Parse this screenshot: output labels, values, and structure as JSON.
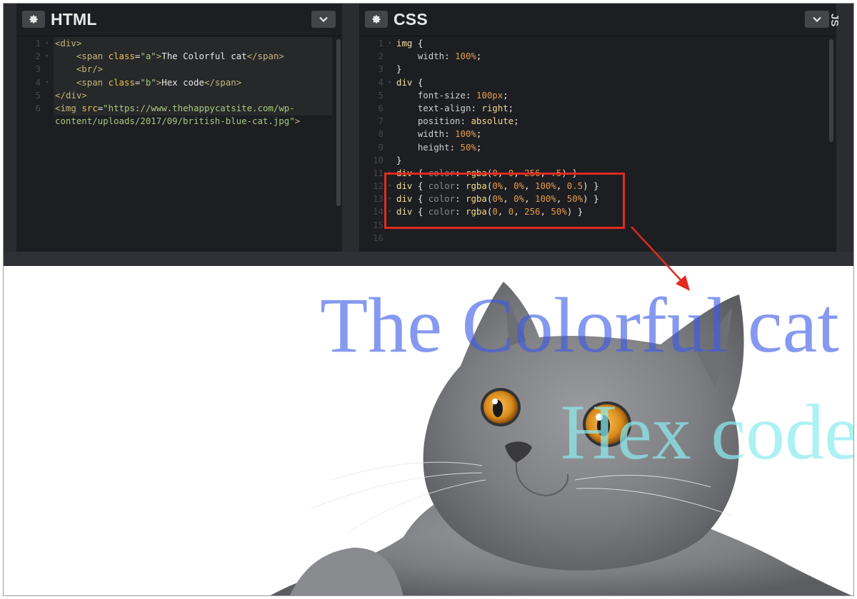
{
  "html_panel": {
    "title": "HTML",
    "lines": [
      {
        "num": "1",
        "fold": "▾",
        "parts": [
          {
            "c": "t-tag",
            "t": "<div>"
          }
        ]
      },
      {
        "num": "2",
        "fold": "▾",
        "parts": [
          {
            "c": "t-punc",
            "t": "    "
          },
          {
            "c": "t-tag",
            "t": "<span "
          },
          {
            "c": "t-attr",
            "t": "class"
          },
          {
            "c": "t-punc",
            "t": "="
          },
          {
            "c": "t-str",
            "t": "\"a\""
          },
          {
            "c": "t-tag",
            "t": ">"
          },
          {
            "c": "t-punc",
            "t": "The Colorful cat"
          },
          {
            "c": "t-tag",
            "t": "</span>"
          }
        ]
      },
      {
        "num": "3",
        "fold": "",
        "parts": [
          {
            "c": "t-punc",
            "t": "    "
          },
          {
            "c": "t-tag",
            "t": "<br/>"
          }
        ]
      },
      {
        "num": "4",
        "fold": "▾",
        "parts": [
          {
            "c": "t-punc",
            "t": "    "
          },
          {
            "c": "t-tag",
            "t": "<span "
          },
          {
            "c": "t-attr",
            "t": "class"
          },
          {
            "c": "t-punc",
            "t": "="
          },
          {
            "c": "t-str",
            "t": "\"b\""
          },
          {
            "c": "t-tag",
            "t": ">"
          },
          {
            "c": "t-punc",
            "t": "Hex code"
          },
          {
            "c": "t-tag",
            "t": "</span>"
          }
        ]
      },
      {
        "num": "5",
        "fold": "",
        "parts": [
          {
            "c": "t-tag",
            "t": "</div>"
          }
        ]
      },
      {
        "num": "6",
        "fold": "",
        "parts": [
          {
            "c": "t-tag",
            "t": "<img "
          },
          {
            "c": "t-attr",
            "t": "src"
          },
          {
            "c": "t-punc",
            "t": "="
          },
          {
            "c": "t-str",
            "t": "\"https://www.thehappycatsite.com/wp-"
          }
        ]
      },
      {
        "num": "",
        "fold": "",
        "parts": [
          {
            "c": "t-str",
            "t": "content/uploads/2017/09/british-blue-cat.jpg\""
          },
          {
            "c": "t-tag",
            "t": ">"
          }
        ]
      }
    ]
  },
  "css_panel": {
    "title": "CSS",
    "lines": [
      {
        "num": "1",
        "fold": "▾",
        "parts": [
          {
            "c": "t-sel",
            "t": "img"
          },
          {
            "c": "t-punc",
            "t": " {"
          }
        ]
      },
      {
        "num": "2",
        "fold": "",
        "parts": [
          {
            "c": "t-prop",
            "t": "    width"
          },
          {
            "c": "t-punc",
            "t": ": "
          },
          {
            "c": "t-num",
            "t": "100%"
          },
          {
            "c": "t-punc",
            "t": ";"
          }
        ]
      },
      {
        "num": "3",
        "fold": "",
        "parts": [
          {
            "c": "t-punc",
            "t": "}"
          }
        ]
      },
      {
        "num": "4",
        "fold": "▾",
        "parts": [
          {
            "c": "t-sel",
            "t": "div"
          },
          {
            "c": "t-punc",
            "t": " {"
          }
        ]
      },
      {
        "num": "5",
        "fold": "",
        "parts": [
          {
            "c": "t-prop",
            "t": "    font-size"
          },
          {
            "c": "t-punc",
            "t": ": "
          },
          {
            "c": "t-num",
            "t": "100px"
          },
          {
            "c": "t-punc",
            "t": ";"
          }
        ]
      },
      {
        "num": "6",
        "fold": "",
        "parts": [
          {
            "c": "t-prop",
            "t": "    text-align"
          },
          {
            "c": "t-punc",
            "t": ": "
          },
          {
            "c": "t-kw",
            "t": "right"
          },
          {
            "c": "t-punc",
            "t": ";"
          }
        ]
      },
      {
        "num": "7",
        "fold": "",
        "parts": [
          {
            "c": "t-prop",
            "t": "    position"
          },
          {
            "c": "t-punc",
            "t": ": "
          },
          {
            "c": "t-kw",
            "t": "absolute"
          },
          {
            "c": "t-punc",
            "t": ";"
          }
        ]
      },
      {
        "num": "8",
        "fold": "",
        "parts": [
          {
            "c": "t-prop",
            "t": "    width"
          },
          {
            "c": "t-punc",
            "t": ": "
          },
          {
            "c": "t-num",
            "t": "100%"
          },
          {
            "c": "t-punc",
            "t": ";"
          }
        ]
      },
      {
        "num": "9",
        "fold": "",
        "parts": [
          {
            "c": "t-prop",
            "t": "    height"
          },
          {
            "c": "t-punc",
            "t": ": "
          },
          {
            "c": "t-num",
            "t": "50%"
          },
          {
            "c": "t-punc",
            "t": ";"
          }
        ]
      },
      {
        "num": "10",
        "fold": "",
        "parts": [
          {
            "c": "t-punc",
            "t": "}"
          }
        ]
      },
      {
        "num": "11",
        "fold": "▾",
        "parts": [
          {
            "c": "t-sel",
            "t": "div"
          },
          {
            "c": "t-punc",
            "t": " { "
          },
          {
            "c": "t-dim",
            "t": "color"
          },
          {
            "c": "t-punc",
            "t": ": "
          },
          {
            "c": "t-kw",
            "t": "rgba"
          },
          {
            "c": "t-punc",
            "t": "("
          },
          {
            "c": "t-num",
            "t": "0"
          },
          {
            "c": "t-punc",
            "t": ", "
          },
          {
            "c": "t-num",
            "t": "0"
          },
          {
            "c": "t-punc",
            "t": ", "
          },
          {
            "c": "t-num",
            "t": "256"
          },
          {
            "c": "t-punc",
            "t": ", "
          },
          {
            "c": "t-num",
            "t": ".5"
          },
          {
            "c": "t-punc",
            "t": ") }"
          }
        ]
      },
      {
        "num": "12",
        "fold": "▾",
        "parts": [
          {
            "c": "t-sel",
            "t": "div"
          },
          {
            "c": "t-punc",
            "t": " { "
          },
          {
            "c": "t-dim",
            "t": "color"
          },
          {
            "c": "t-punc",
            "t": ": "
          },
          {
            "c": "t-kw",
            "t": "rgba"
          },
          {
            "c": "t-punc",
            "t": "("
          },
          {
            "c": "t-num",
            "t": "0%"
          },
          {
            "c": "t-punc",
            "t": ", "
          },
          {
            "c": "t-num",
            "t": "0%"
          },
          {
            "c": "t-punc",
            "t": ", "
          },
          {
            "c": "t-num",
            "t": "100%"
          },
          {
            "c": "t-punc",
            "t": ", "
          },
          {
            "c": "t-num",
            "t": "0.5"
          },
          {
            "c": "t-punc",
            "t": ") }"
          }
        ]
      },
      {
        "num": "13",
        "fold": "▾",
        "parts": [
          {
            "c": "t-sel",
            "t": "div"
          },
          {
            "c": "t-punc",
            "t": " { "
          },
          {
            "c": "t-dim",
            "t": "color"
          },
          {
            "c": "t-punc",
            "t": ": "
          },
          {
            "c": "t-kw",
            "t": "rgba"
          },
          {
            "c": "t-punc",
            "t": "("
          },
          {
            "c": "t-num",
            "t": "0%"
          },
          {
            "c": "t-punc",
            "t": ", "
          },
          {
            "c": "t-num",
            "t": "0%"
          },
          {
            "c": "t-punc",
            "t": ", "
          },
          {
            "c": "t-num",
            "t": "100%"
          },
          {
            "c": "t-punc",
            "t": ", "
          },
          {
            "c": "t-num",
            "t": "50%"
          },
          {
            "c": "t-punc",
            "t": ") }"
          }
        ]
      },
      {
        "num": "14",
        "fold": "▾",
        "parts": [
          {
            "c": "t-sel",
            "t": "div"
          },
          {
            "c": "t-punc",
            "t": " { "
          },
          {
            "c": "t-dim",
            "t": "color"
          },
          {
            "c": "t-punc",
            "t": ": "
          },
          {
            "c": "t-kw",
            "t": "rgba"
          },
          {
            "c": "t-punc",
            "t": "("
          },
          {
            "c": "t-num",
            "t": "0"
          },
          {
            "c": "t-punc",
            "t": ", "
          },
          {
            "c": "t-num",
            "t": "0"
          },
          {
            "c": "t-punc",
            "t": ", "
          },
          {
            "c": "t-num",
            "t": "256"
          },
          {
            "c": "t-punc",
            "t": ", "
          },
          {
            "c": "t-num",
            "t": "50%"
          },
          {
            "c": "t-punc",
            "t": ") }"
          }
        ]
      },
      {
        "num": "15",
        "fold": "",
        "parts": []
      },
      {
        "num": "16",
        "fold": "",
        "parts": []
      }
    ]
  },
  "js_tab": {
    "label": "JS"
  },
  "preview": {
    "line_a": "The Colorful cat",
    "line_b": "Hex code"
  },
  "colors": {
    "editor_bg": "#1d1e22",
    "highlight_box": "#e02b20",
    "annotation_arrow": "#e02b20"
  },
  "icons": {
    "panel_settings": "gear-icon",
    "panel_collapse": "chevron-down-icon",
    "preview_image": "cat-photo"
  }
}
